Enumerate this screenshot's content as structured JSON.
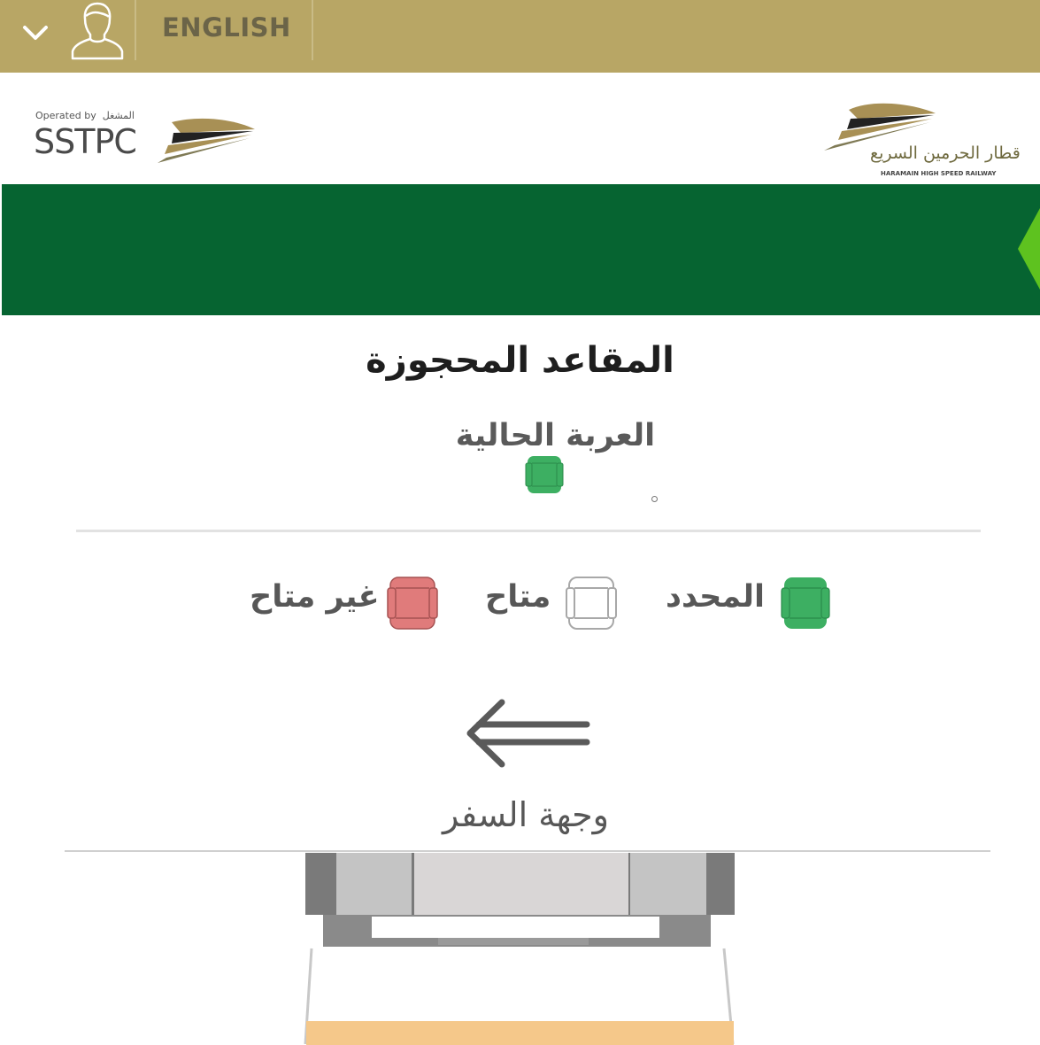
{
  "topbar": {
    "language_label": "ENGLISH",
    "background_color": "#b8a665",
    "icons": [
      "chevron-down-icon",
      "user-icon"
    ]
  },
  "logos": {
    "operator_prefix": "Operated by",
    "operator_prefix_ar": "المشغل",
    "operator_name": "SSTPC",
    "railway_name_ar": "قطار الحرمين السريع",
    "railway_name_en": "HARAMAIN HIGH SPEED RAILWAY"
  },
  "banner": {
    "color": "#066431",
    "accent_color": "#5ec21f"
  },
  "seats": {
    "title": "المقاعد المحجوزة",
    "current_coach_label": "العربة الحالية",
    "legend": {
      "selected": "المحدد",
      "available": "متاح",
      "unavailable": "غير متاح"
    },
    "colors": {
      "selected": "#3daf62",
      "available": "#ffffff",
      "unavailable": "#e07b7b"
    },
    "direction_label": "وجهة السفر"
  }
}
